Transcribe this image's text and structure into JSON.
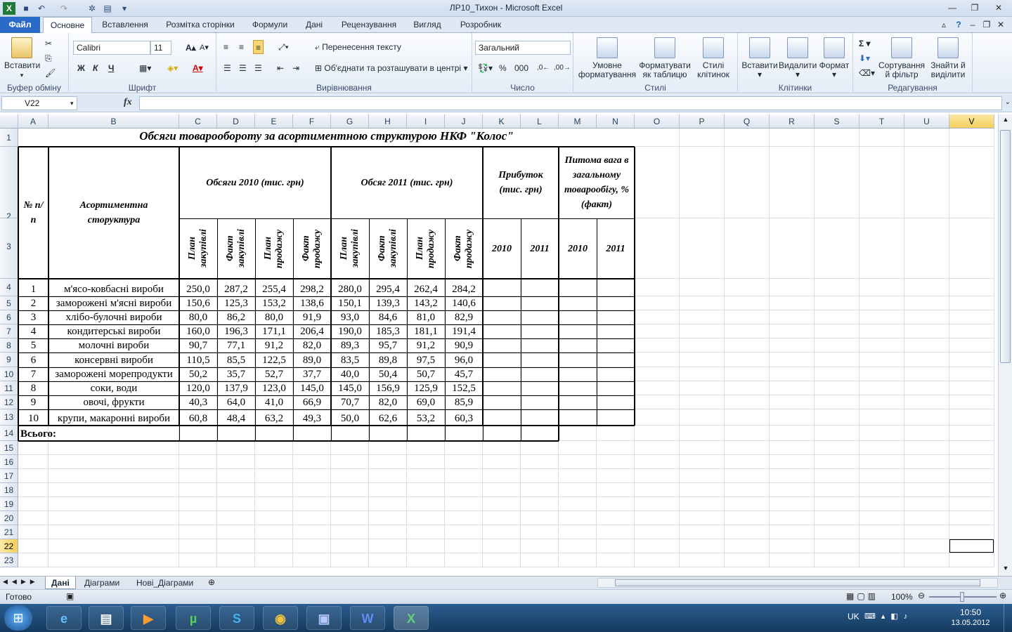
{
  "window": {
    "title": "ЛР10_Тихон  -  Microsoft Excel",
    "accent": "#2a6ac9"
  },
  "tabs": {
    "file": "Файл",
    "home": "Основне",
    "insert": "Вставлення",
    "layout": "Розмітка сторінки",
    "formulas": "Формули",
    "data": "Дані",
    "review": "Рецензування",
    "view": "Вигляд",
    "developer": "Розробник"
  },
  "ribbon": {
    "clipboard": {
      "paste": "Вставити",
      "label": "Буфер обміну"
    },
    "font": {
      "name": "Calibri",
      "size": "11",
      "bold": "Ж",
      "italic": "К",
      "underline": "Ч",
      "label": "Шрифт"
    },
    "alignment": {
      "wrap": "Перенесення тексту",
      "merge": "Об'єднати та розташувати в центрі",
      "label": "Вирівнювання"
    },
    "number": {
      "format": "Загальний",
      "label": "Число"
    },
    "styles": {
      "conditional": "Умовне форматування",
      "as_table": "Форматувати як таблицю",
      "cell_styles": "Стилі клітинок",
      "label": "Стилі"
    },
    "cells": {
      "insert": "Вставити",
      "delete": "Видалити",
      "format": "Формат",
      "label": "Клітинки"
    },
    "editing": {
      "sort": "Сортування й фільтр",
      "find": "Знайти й виділити",
      "label": "Редагування"
    }
  },
  "formula_bar": {
    "name_box": "V22",
    "fx": "fx",
    "value": ""
  },
  "columns": [
    "A",
    "B",
    "C",
    "D",
    "E",
    "F",
    "G",
    "H",
    "I",
    "J",
    "K",
    "L",
    "M",
    "N",
    "O",
    "P",
    "Q",
    "R",
    "S",
    "T",
    "U",
    "V"
  ],
  "selected_column": "V",
  "rows": [
    "1",
    "2",
    "3",
    "4",
    "5",
    "6",
    "7",
    "8",
    "9",
    "10",
    "11",
    "12",
    "13",
    "14",
    "15",
    "16",
    "17",
    "18",
    "19",
    "20",
    "21",
    "22",
    "23"
  ],
  "selected_row": "22",
  "sheet": {
    "title": "Обсяги товарообороту за асортиментною структурою НКФ \"Колос\"",
    "h_num": "№ п/п",
    "h_assort": "Асортиментна сторуктура",
    "h_2010": "Обсяги 2010 (тис. грн)",
    "h_2011": "Обсяг 2011 (тис. грн)",
    "h_profit": "Прибуток (тис. грн)",
    "h_share": "Питома вага в загальному товарообігу, % (факт)",
    "sub": [
      "План закупівлі",
      "Факт закупівлі",
      "План продажу",
      "Факт продажу",
      "План закупівлі",
      "Факт закупівлі",
      "План продажу",
      "Факт продажу"
    ],
    "years": [
      "2010",
      "2011",
      "2010",
      "2011"
    ],
    "data": [
      [
        "1",
        "м'ясо-ковбасні вироби",
        "250,0",
        "287,2",
        "255,4",
        "298,2",
        "280,0",
        "295,4",
        "262,4",
        "284,2"
      ],
      [
        "2",
        "заморожені м'ясні вироби",
        "150,6",
        "125,3",
        "153,2",
        "138,6",
        "150,1",
        "139,3",
        "143,2",
        "140,6"
      ],
      [
        "3",
        "хлібо-булочні вироби",
        "80,0",
        "86,2",
        "80,0",
        "91,9",
        "93,0",
        "84,6",
        "81,0",
        "82,9"
      ],
      [
        "4",
        "кондитерські вироби",
        "160,0",
        "196,3",
        "171,1",
        "206,4",
        "190,0",
        "185,3",
        "181,1",
        "191,4"
      ],
      [
        "5",
        "молочні вироби",
        "90,7",
        "77,1",
        "91,2",
        "82,0",
        "89,3",
        "95,7",
        "91,2",
        "90,9"
      ],
      [
        "6",
        "консервні вироби",
        "110,5",
        "85,5",
        "122,5",
        "89,0",
        "83,5",
        "89,8",
        "97,5",
        "96,0"
      ],
      [
        "7",
        "заморожені морепродукти",
        "50,2",
        "35,7",
        "52,7",
        "37,7",
        "40,0",
        "50,4",
        "50,7",
        "45,7"
      ],
      [
        "8",
        "соки, води",
        "120,0",
        "137,9",
        "123,0",
        "145,0",
        "145,0",
        "156,9",
        "125,9",
        "152,5"
      ],
      [
        "9",
        "овочі, фрукти",
        "40,3",
        "64,0",
        "41,0",
        "66,9",
        "70,7",
        "82,0",
        "69,0",
        "85,9"
      ],
      [
        "10",
        "крупи, макаронні вироби",
        "60,8",
        "48,4",
        "63,2",
        "49,3",
        "50,0",
        "62,6",
        "53,2",
        "60,3"
      ]
    ],
    "total": "Всього:"
  },
  "sheet_tabs": [
    "Дані",
    "Діаграми",
    "Нові_Діаграми"
  ],
  "status": {
    "ready": "Готово",
    "zoom": "100%"
  },
  "taskbar": {
    "lang": "UK",
    "time": "10:50",
    "date": "13.05.2012"
  }
}
